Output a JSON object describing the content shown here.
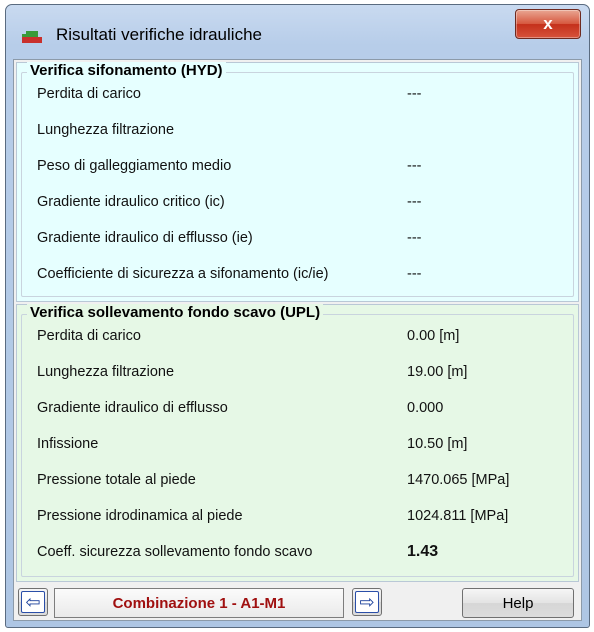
{
  "window": {
    "title": "Risultati verifiche idrauliche",
    "close_label": "x"
  },
  "panel_hyd": {
    "title": "Verifica sifonamento (HYD)",
    "rows": [
      {
        "label": "Perdita di carico",
        "value": "---"
      },
      {
        "label": "Lunghezza filtrazione",
        "value": ""
      },
      {
        "label": "Peso di galleggiamento medio",
        "value": "---"
      },
      {
        "label": "Gradiente idraulico critico (ic)",
        "value": "---"
      },
      {
        "label": "Gradiente idraulico di efflusso (ie)",
        "value": "---"
      },
      {
        "label": "Coefficiente di sicurezza a sifonamento (ic/ie)",
        "value": "---"
      }
    ]
  },
  "panel_upl": {
    "title": "Verifica sollevamento fondo scavo (UPL)",
    "rows": [
      {
        "label": "Perdita di carico",
        "value": "0.00 [m]"
      },
      {
        "label": "Lunghezza filtrazione",
        "value": "19.00 [m]"
      },
      {
        "label": "Gradiente idraulico di efflusso",
        "value": "0.000"
      },
      {
        "label": "Infissione",
        "value": "10.50 [m]"
      },
      {
        "label": "Pressione totale al piede",
        "value": "1470.065 [MPa]"
      },
      {
        "label": "Pressione idrodinamica al  piede",
        "value": "1024.811 [MPa]"
      },
      {
        "label": "Coeff. sicurezza sollevamento fondo scavo",
        "value": "1.43"
      }
    ]
  },
  "footer": {
    "prev_label": "⇦",
    "combination_label": "Combinazione 1 - A1-M1",
    "next_label": "⇨",
    "help_label": "Help"
  },
  "colors": {
    "hyd_background": "#e6ffff",
    "upl_background": "#e6f8e6",
    "combination_text": "#a01010",
    "arrow": "#1a3f9a"
  }
}
